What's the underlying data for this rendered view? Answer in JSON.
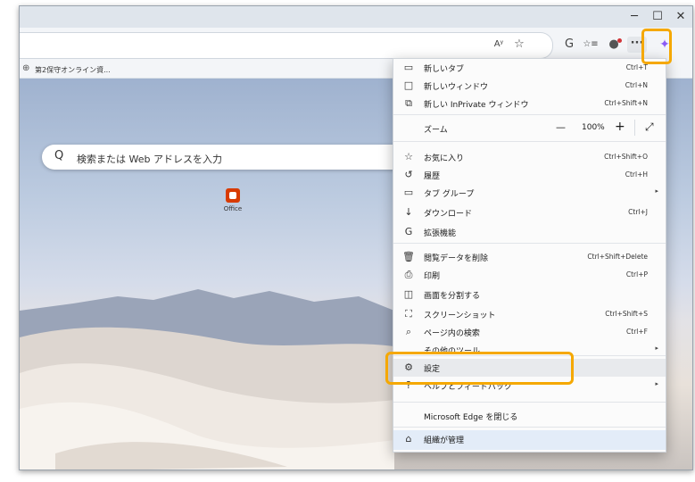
{
  "window": {
    "minimize": "─",
    "maximize": "☐",
    "close": "✕"
  },
  "toolbar": {
    "read_aloud": "Aʸ",
    "favorite": "☆",
    "refresh": "G",
    "collections": "☆≡",
    "profile": "●",
    "more": "···",
    "copilot": "✦"
  },
  "favorites_bar": {
    "item_label": "第2保守オンライン資..."
  },
  "newtab": {
    "search_placeholder": "検索または Web アドレスを入力",
    "search_icon": "Q",
    "tile_label": "Office"
  },
  "menu": {
    "items": [
      {
        "label": "新しいタブ",
        "shortcut": "Ctrl+T",
        "icon": "tab-icon"
      },
      {
        "label": "新しいウィンドウ",
        "shortcut": "Ctrl+N",
        "icon": "window-icon"
      },
      {
        "label": "新しい InPrivate ウィンドウ",
        "shortcut": "Ctrl+Shift+N",
        "icon": "inprivate-icon"
      },
      {
        "label": "お気に入り",
        "shortcut": "Ctrl+Shift+O",
        "icon": "favorites-icon"
      },
      {
        "label": "履歴",
        "shortcut": "Ctrl+H",
        "icon": "history-icon"
      },
      {
        "label": "タブ グループ",
        "shortcut": "",
        "icon": "tab-group-icon",
        "submenu": true
      },
      {
        "label": "ダウンロード",
        "shortcut": "Ctrl+J",
        "icon": "download-icon"
      },
      {
        "label": "拡張機能",
        "shortcut": "",
        "icon": "extensions-icon"
      },
      {
        "label": "閲覧データを削除",
        "shortcut": "Ctrl+Shift+Delete",
        "icon": "trash-icon"
      },
      {
        "label": "印刷",
        "shortcut": "Ctrl+P",
        "icon": "print-icon"
      },
      {
        "label": "画面を分割する",
        "shortcut": "",
        "icon": "split-screen-icon"
      },
      {
        "label": "スクリーンショット",
        "shortcut": "Ctrl+Shift+S",
        "icon": "screenshot-icon"
      },
      {
        "label": "ページ内の検索",
        "shortcut": "Ctrl+F",
        "icon": "find-icon"
      },
      {
        "label": "その他のツール",
        "shortcut": "",
        "icon": "tools-icon",
        "submenu": true
      },
      {
        "label": "設定",
        "shortcut": "",
        "icon": "gear-icon"
      },
      {
        "label": "ヘルプとフィードバック",
        "shortcut": "",
        "icon": "help-icon",
        "submenu": true
      },
      {
        "label": "Microsoft Edge を閉じる",
        "shortcut": "",
        "icon": ""
      },
      {
        "label": "組織が管理",
        "shortcut": "",
        "icon": "briefcase-icon"
      }
    ],
    "zoom": {
      "label": "ズーム",
      "value": "100%",
      "minus": "—",
      "plus": "+",
      "fullscreen": "⤢"
    }
  },
  "colors": {
    "highlight": "#f5a800",
    "menu_hover": "#e8eaed",
    "managed_bg": "#e3ecf8"
  }
}
